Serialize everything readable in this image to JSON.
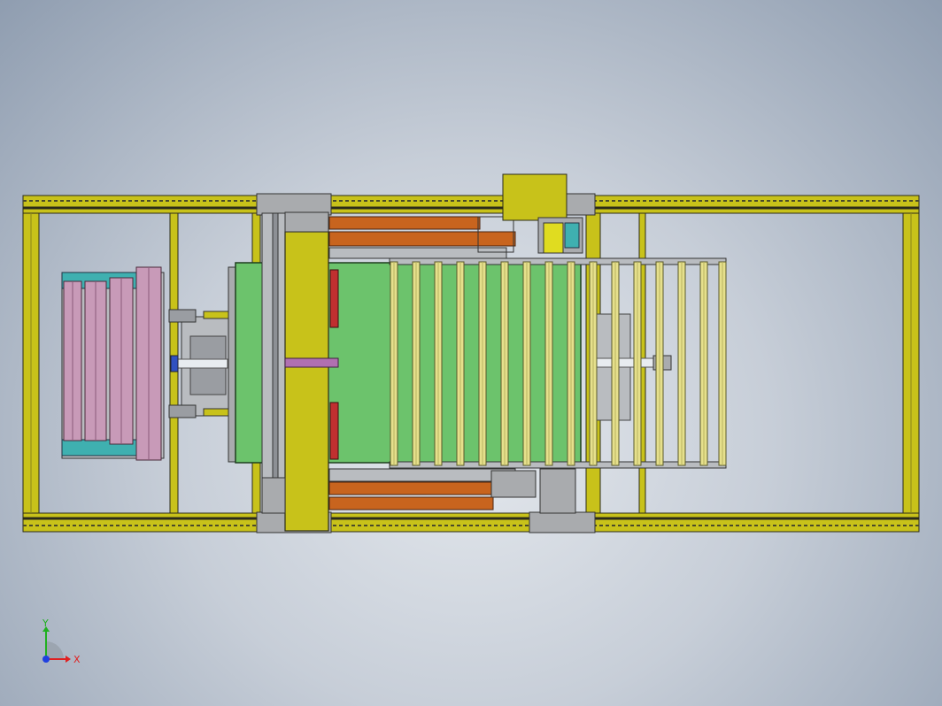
{
  "triad": {
    "x_label": "X",
    "y_label": "Y"
  },
  "colors": {
    "background_light": "#e4e8ed",
    "background_dark": "#8f9db0",
    "frame_yellow": "#c8c21a",
    "frame_dark": "#3a3a2a",
    "deck_green": "#6cc36c",
    "roller_yellow": "#e6e08c",
    "bracket_orange": "#c8641e",
    "stopper_red": "#c03030",
    "magazine_pink": "#c89ab8",
    "magazine_teal": "#3fb0b0",
    "plate_gray": "#b9bcc0",
    "axis_x": "#e02020",
    "axis_y": "#20b020",
    "axis_z": "#2040e0"
  }
}
